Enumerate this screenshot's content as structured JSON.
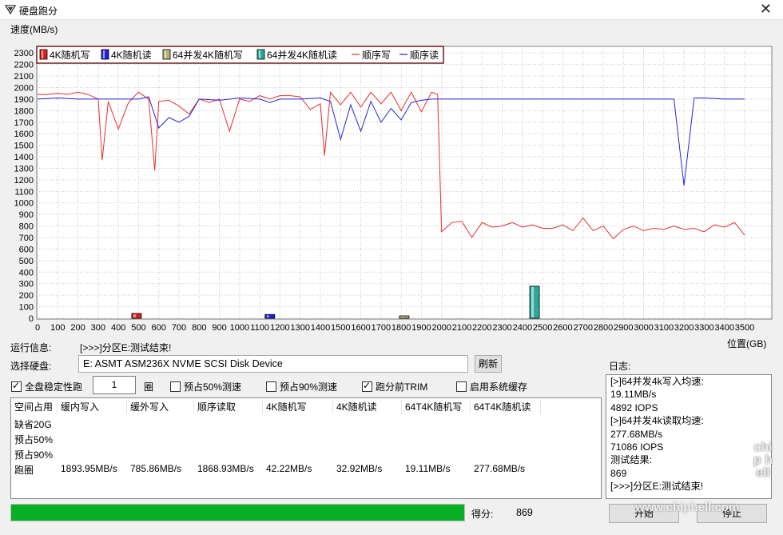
{
  "window": {
    "title": "硬盘跑分",
    "close_glyph": "✕"
  },
  "chart_data": {
    "type": "line",
    "ylabel": "速度(MB/s)",
    "xlabel": "位置(GB)",
    "xlim": [
      0,
      3550
    ],
    "ylim": [
      0,
      2350
    ],
    "x_ticks": [
      0,
      100,
      200,
      300,
      400,
      500,
      600,
      700,
      800,
      900,
      1000,
      1100,
      1200,
      1300,
      1400,
      1500,
      1600,
      1700,
      1800,
      1900,
      2000,
      2100,
      2200,
      2300,
      2400,
      2500,
      2600,
      2700,
      2800,
      2900,
      3000,
      3100,
      3200,
      3300,
      3400,
      3500
    ],
    "y_ticks": [
      0,
      100,
      200,
      300,
      400,
      500,
      600,
      700,
      800,
      900,
      1000,
      1100,
      1200,
      1300,
      1400,
      1500,
      1600,
      1700,
      1800,
      1900,
      2000,
      2100,
      2200,
      2300
    ],
    "grid": true,
    "legend_position": "top-left",
    "legend": [
      {
        "label": "4K随机写",
        "kind": "box",
        "color": "#e02020"
      },
      {
        "label": "4K随机读",
        "kind": "box",
        "color": "#2020e0"
      },
      {
        "label": "64并发4K随机写",
        "kind": "box",
        "color": "#b8b070"
      },
      {
        "label": "64并发4K随机读",
        "kind": "box",
        "color": "#2aa89a"
      },
      {
        "label": "顺序写",
        "kind": "line",
        "color": "#e83030"
      },
      {
        "label": "顺序读",
        "kind": "line",
        "color": "#2626d8"
      }
    ],
    "bars": [
      {
        "name": "4K随机写",
        "x": 490,
        "value": 42,
        "color": "#e02020"
      },
      {
        "name": "4K随机读",
        "x": 1150,
        "value": 33,
        "color": "#2020e0"
      },
      {
        "name": "64并发4K随机写",
        "x": 1815,
        "value": 19,
        "color": "#b8b070"
      },
      {
        "name": "64并发4K随机读",
        "x": 2460,
        "value": 278,
        "color": "#2aa89a"
      }
    ],
    "series": [
      {
        "name": "顺序写",
        "color": "#e83030",
        "x": [
          0,
          50,
          100,
          150,
          200,
          250,
          300,
          320,
          350,
          400,
          450,
          500,
          550,
          580,
          600,
          650,
          700,
          750,
          800,
          850,
          900,
          950,
          1000,
          1050,
          1100,
          1150,
          1200,
          1250,
          1300,
          1350,
          1400,
          1420,
          1450,
          1500,
          1550,
          1600,
          1650,
          1700,
          1750,
          1800,
          1850,
          1900,
          1950,
          1980,
          2000,
          2050,
          2100,
          2150,
          2200,
          2250,
          2300,
          2350,
          2400,
          2450,
          2500,
          2550,
          2600,
          2650,
          2700,
          2750,
          2800,
          2850,
          2900,
          2950,
          3000,
          3050,
          3100,
          3150,
          3200,
          3250,
          3300,
          3350,
          3400,
          3450,
          3500
        ],
        "y": [
          1940,
          1940,
          1950,
          1940,
          1960,
          1940,
          1900,
          1370,
          1880,
          1640,
          1870,
          1960,
          1900,
          1280,
          1880,
          1890,
          1840,
          1770,
          1900,
          1870,
          1900,
          1620,
          1900,
          1880,
          1930,
          1900,
          1930,
          1930,
          1920,
          1810,
          1860,
          1410,
          1960,
          1850,
          1960,
          1830,
          1960,
          1860,
          1960,
          1800,
          1960,
          1790,
          1960,
          1940,
          750,
          830,
          840,
          700,
          830,
          790,
          800,
          830,
          790,
          810,
          780,
          780,
          810,
          760,
          870,
          760,
          800,
          690,
          770,
          800,
          760,
          780,
          770,
          800,
          770,
          780,
          750,
          810,
          790,
          830,
          720
        ]
      },
      {
        "name": "顺序读",
        "color": "#2626d8",
        "x": [
          0,
          100,
          200,
          300,
          400,
          500,
          550,
          600,
          650,
          700,
          750,
          800,
          900,
          1000,
          1100,
          1150,
          1200,
          1300,
          1400,
          1450,
          1500,
          1550,
          1600,
          1650,
          1700,
          1750,
          1800,
          1850,
          1900,
          1950,
          2000,
          2100,
          2200,
          2300,
          2400,
          2500,
          2600,
          2700,
          2800,
          2900,
          3000,
          3100,
          3150,
          3200,
          3250,
          3300,
          3400,
          3500
        ],
        "y": [
          1900,
          1910,
          1900,
          1900,
          1900,
          1900,
          1920,
          1650,
          1740,
          1700,
          1750,
          1900,
          1890,
          1910,
          1900,
          1870,
          1900,
          1900,
          1910,
          1880,
          1550,
          1850,
          1620,
          1880,
          1700,
          1820,
          1720,
          1870,
          1890,
          1900,
          1900,
          1900,
          1900,
          1900,
          1900,
          1900,
          1900,
          1900,
          1900,
          1900,
          1900,
          1900,
          1900,
          1150,
          1910,
          1910,
          1900,
          1900
        ]
      }
    ]
  },
  "status": {
    "label": "运行信息:",
    "value": "[>>>]分区E:测试结束!"
  },
  "disk": {
    "label": "选择硬盘:",
    "selected": "E: ASMT ASM236X NVME SCSI Disk Device",
    "refresh": "刷新"
  },
  "options": {
    "full_disk": {
      "label": "全盘稳定性跑",
      "checked": true
    },
    "laps_value": "1",
    "laps_unit": "圈",
    "fill50": {
      "label": "预占50%测速",
      "checked": false
    },
    "fill90": {
      "label": "预占90%测速",
      "checked": false
    },
    "trim": {
      "label": "跑分前TRIM",
      "checked": true
    },
    "cache": {
      "label": "启用系统缓存",
      "checked": false
    }
  },
  "results": {
    "headers": [
      "空间占用",
      "缓内写入",
      "缓外写入",
      "顺序读取",
      "4K随机写",
      "4K随机读",
      "64T4K随机写",
      "64T4K随机读"
    ],
    "rows": [
      {
        "label": "缺省20G",
        "values": [
          "",
          "",
          "",
          "",
          "",
          "",
          ""
        ]
      },
      {
        "label": "预占50%",
        "values": [
          "",
          "",
          "",
          "",
          "",
          "",
          ""
        ]
      },
      {
        "label": "预占90%",
        "values": [
          "",
          "",
          "",
          "",
          "",
          "",
          ""
        ]
      },
      {
        "label": "跑圈",
        "values": [
          "1893.95MB/s",
          "785.86MB/s",
          "1868.93MB/s",
          "42.22MB/s",
          "32.92MB/s",
          "19.11MB/s",
          "277.68MB/s"
        ]
      }
    ]
  },
  "log": {
    "label": "日志:",
    "lines": [
      "[>]64并发4k写入均速:",
      "19.11MB/s",
      "4892 IOPS",
      "[>]64并发4k读取均速:",
      "277.68MB/s",
      "71086 IOPS",
      "测试结果:",
      "869",
      "[>>>]分区E:测试结束!"
    ]
  },
  "progress": {
    "value": 1.0,
    "score_label": "得分:",
    "score": "869"
  },
  "buttons": {
    "start": "开始",
    "stop": "停止"
  },
  "watermark": {
    "site": "www.chiphell.com",
    "logo": "chip hell"
  }
}
